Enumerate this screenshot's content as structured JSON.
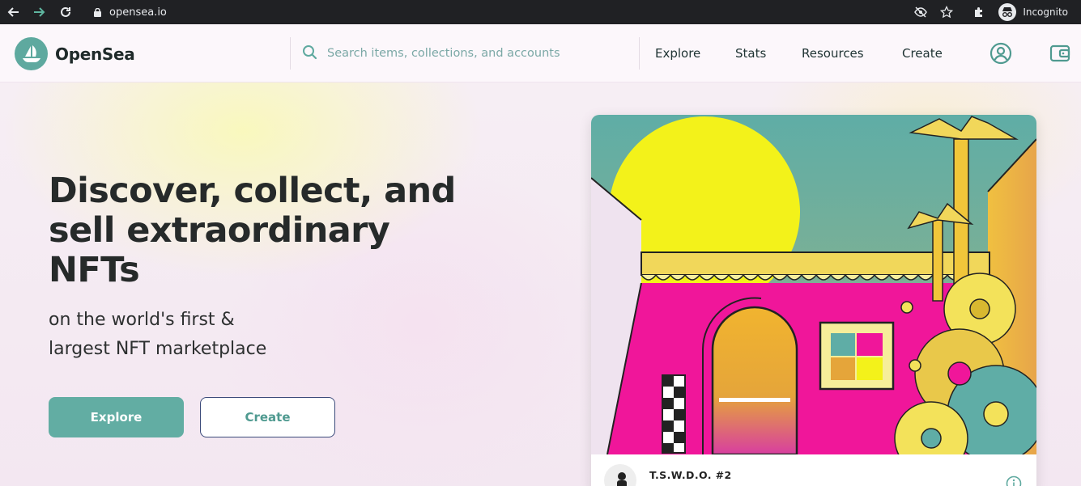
{
  "browser": {
    "url": "opensea.io",
    "profile_label": "Incognito"
  },
  "site": {
    "brand": "OpenSea",
    "search_placeholder": "Search items, collections, and accounts",
    "nav": [
      "Explore",
      "Stats",
      "Resources",
      "Create"
    ]
  },
  "hero": {
    "headline_line1": "Discover, collect, and",
    "headline_line2": "sell extraordinary",
    "headline_line3": "NFTs",
    "sub_line1": "on the world's first &",
    "sub_line2": "largest NFT marketplace",
    "explore_label": "Explore",
    "create_label": "Create"
  },
  "featured": {
    "title": "T.S.W.D.O. #2"
  },
  "colors": {
    "accent": "#62ada3",
    "headline": "#262a2a",
    "art_sky": "#5fada6",
    "art_sun": "#f3f21a",
    "art_wall": "#f0169a"
  }
}
